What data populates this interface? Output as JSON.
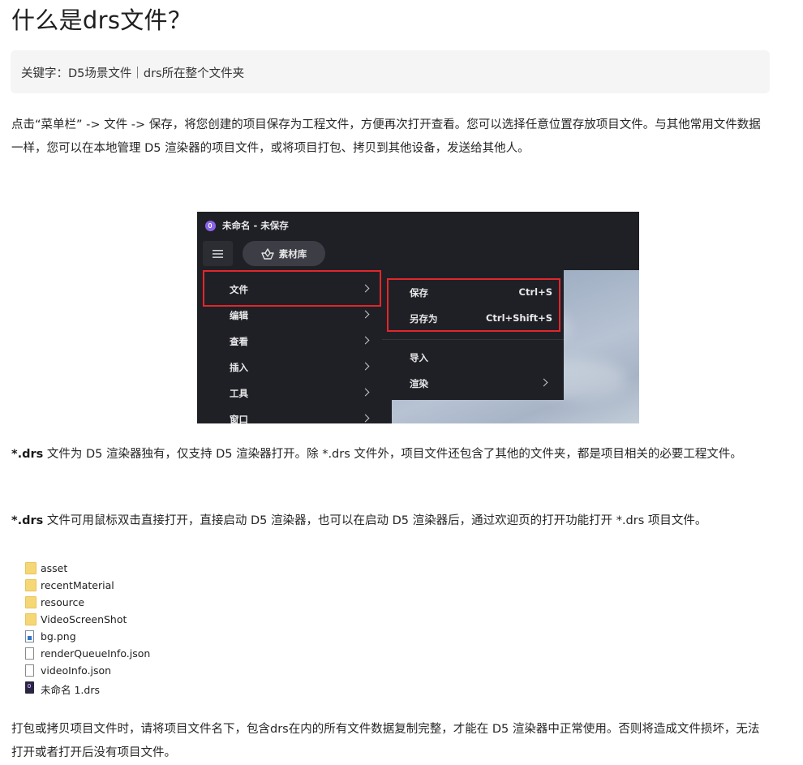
{
  "page": {
    "title": "什么是drs文件？",
    "keywords": "关键字：D5场景文件｜drs所在整个文件夹",
    "para1": "点击“菜单栏” -> 文件 -> 保存，将您创建的项目保存为工程文件，方便再次打开查看。您可以选择任意位置存放项目文件。与其他常用文件数据一样，您可以在本地管理 D5 渲染器的项目文件，或将项目打包、拷贝到其他设备，发送给其他人。",
    "para2_bold": "*.drs",
    "para2_rest": " 文件为 D5 渲染器独有，仅支持 D5 渲染器打开。除 *.drs 文件外，项目文件还包含了其他的文件夹，都是项目相关的必要工程文件。",
    "para3_bold": "*.drs",
    "para3_rest": " 文件可用鼠标双击直接打开，直接启动 D5 渲染器，也可以在启动 D5 渲染器后，通过欢迎页的打开功能打开 *.drs 项目文件。",
    "para4": "打包或拷贝项目文件时，请将项目文件名下，包含drs在内的所有文件数据复制完整，才能在 D5 渲染器中正常使用。否则将造成文件损坏，无法打开或者打开后没有项目文件。"
  },
  "screenshot": {
    "window_title": "未命名 - 未保存",
    "library_button": "素材库",
    "menu": [
      {
        "label": "文件"
      },
      {
        "label": "编辑"
      },
      {
        "label": "查看"
      },
      {
        "label": "插入"
      },
      {
        "label": "工具"
      },
      {
        "label": "窗口"
      }
    ],
    "submenu": [
      {
        "label": "保存",
        "shortcut": "Ctrl+S"
      },
      {
        "label": "另存为",
        "shortcut": "Ctrl+Shift+S"
      },
      {
        "label": "导入",
        "shortcut": ""
      },
      {
        "label": "渲染",
        "shortcut": ""
      }
    ],
    "highlight_color": "#e3262b"
  },
  "files": [
    {
      "name": "asset",
      "icon": "folder-icon"
    },
    {
      "name": "recentMaterial",
      "icon": "folder-icon"
    },
    {
      "name": "resource",
      "icon": "folder-icon"
    },
    {
      "name": "VideoScreenShot",
      "icon": "folder-icon"
    },
    {
      "name": "bg.png",
      "icon": "image-file-icon"
    },
    {
      "name": "renderQueueInfo.json",
      "icon": "file-icon"
    },
    {
      "name": "videoInfo.json",
      "icon": "file-icon"
    },
    {
      "name": "未命名 1.drs",
      "icon": "drs-file-icon"
    }
  ]
}
